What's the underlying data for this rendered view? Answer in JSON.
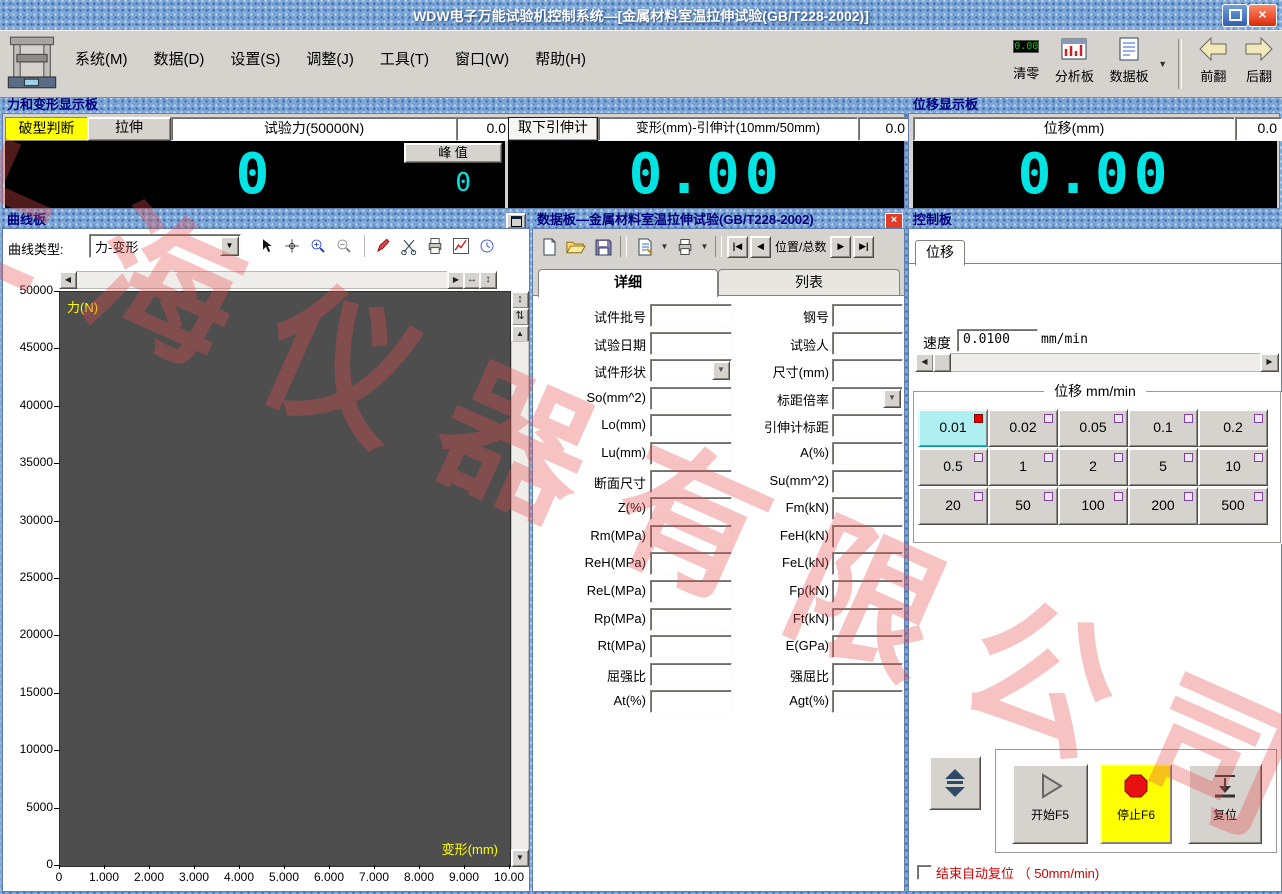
{
  "titlebar": {
    "title": "WDW电子万能试验机控制系统—[金属材料室温拉伸试验(GB/T228-2002)]"
  },
  "menubar": {
    "items": [
      "系统(M)",
      "数据(D)",
      "设置(S)",
      "调整(J)",
      "工具(T)",
      "窗口(W)",
      "帮助(H)"
    ],
    "tools": {
      "clear_zero": "清零",
      "analysis_board": "分析板",
      "data_board": "数据板",
      "prev_page": "前翻",
      "next_page": "后翻"
    }
  },
  "force_panel": {
    "title": "力和变形显示板",
    "break_judge_label": "破型判断",
    "tensile_label": "拉伸",
    "force_field_label": "试验力(50000N)",
    "force_value": "0.0",
    "force_display": "0",
    "peak_label": "峰 值",
    "peak_value": "0",
    "remove_extensometer_label": "取下引伸计",
    "deform_field_label": "变形(mm)-引伸计(10mm/50mm)",
    "deform_value": "0.0",
    "deform_display": "0.00"
  },
  "displacement_panel": {
    "title": "位移显示板",
    "field_label": "位移(mm)",
    "value": "0.0",
    "display": "0.00"
  },
  "curve_panel": {
    "title": "曲线板",
    "curve_type_label": "曲线类型:",
    "curve_type_value": "力-变形",
    "y_axis_name": "力(N)",
    "x_axis_name": "变形(mm)",
    "y_ticks": [
      "50000",
      "45000",
      "40000",
      "35000",
      "30000",
      "25000",
      "20000",
      "15000",
      "10000",
      "5000",
      "0"
    ],
    "x_ticks": [
      "0",
      "1.000",
      "2.000",
      "3.000",
      "4.000",
      "5.000",
      "6.000",
      "7.000",
      "8.000",
      "9.000",
      "10.00"
    ]
  },
  "chart_data": {
    "type": "line",
    "title": "力-变形",
    "xlabel": "变形(mm)",
    "ylabel": "力(N)",
    "xlim": [
      0,
      10
    ],
    "ylim": [
      0,
      50000
    ],
    "grid": false,
    "series": []
  },
  "data_panel": {
    "title": "数据板—金属材料室温拉伸试验(GB/T228-2002)",
    "nav_label": "位置/总数",
    "tabs": [
      "详细",
      "列表"
    ],
    "active_tab": "详细",
    "rows": [
      {
        "left_label": "试件批号",
        "left_value": "",
        "left_type": "text",
        "right_label": "钢号",
        "right_value": "",
        "right_type": "text"
      },
      {
        "left_label": "试验日期",
        "left_value": "",
        "left_type": "text",
        "right_label": "试验人",
        "right_value": "",
        "right_type": "text"
      },
      {
        "left_label": "试件形状",
        "left_value": "",
        "left_type": "select",
        "right_label": "尺寸(mm)",
        "right_value": "",
        "right_type": "text"
      },
      {
        "left_label": "So(mm^2)",
        "left_value": "",
        "left_type": "text",
        "right_label": "标距倍率",
        "right_value": "",
        "right_type": "select"
      },
      {
        "left_label": "Lo(mm)",
        "left_value": "",
        "left_type": "text",
        "right_label": "引伸计标距",
        "right_value": "",
        "right_type": "text"
      },
      {
        "left_label": "Lu(mm)",
        "left_value": "",
        "left_type": "text",
        "right_label": "A(%)",
        "right_value": "",
        "right_type": "text"
      },
      {
        "left_label": "断面尺寸",
        "left_value": "",
        "left_type": "text",
        "right_label": "Su(mm^2)",
        "right_value": "",
        "right_type": "text"
      },
      {
        "left_label": "Z(%)",
        "left_value": "",
        "left_type": "text",
        "right_label": "Fm(kN)",
        "right_value": "",
        "right_type": "text"
      },
      {
        "left_label": "Rm(MPa)",
        "left_value": "",
        "left_type": "text",
        "right_label": "FeH(kN)",
        "right_value": "",
        "right_type": "text"
      },
      {
        "left_label": "ReH(MPa)",
        "left_value": "",
        "left_type": "text",
        "right_label": "FeL(kN)",
        "right_value": "",
        "right_type": "text"
      },
      {
        "left_label": "ReL(MPa)",
        "left_value": "",
        "left_type": "text",
        "right_label": "Fp(kN)",
        "right_value": "",
        "right_type": "text"
      },
      {
        "left_label": "Rp(MPa)",
        "left_value": "",
        "left_type": "text",
        "right_label": "Ft(kN)",
        "right_value": "",
        "right_type": "text"
      },
      {
        "left_label": "Rt(MPa)",
        "left_value": "",
        "left_type": "text",
        "right_label": "E(GPa)",
        "right_value": "",
        "right_type": "text"
      },
      {
        "left_label": "屈强比",
        "left_value": "",
        "left_type": "text",
        "right_label": "强屈比",
        "right_value": "",
        "right_type": "text"
      },
      {
        "left_label": "At(%)",
        "left_value": "",
        "left_type": "text",
        "right_label": "Agt(%)",
        "right_value": "",
        "right_type": "text"
      }
    ]
  },
  "control_panel": {
    "title": "控制板",
    "tab_label": "位移",
    "speed_label": "速度",
    "speed_value": "0.0100",
    "speed_unit": "mm/min",
    "group_title": "位移 mm/min",
    "speed_options": [
      "0.01",
      "0.02",
      "0.05",
      "0.1",
      "0.2",
      "0.5",
      "1",
      "2",
      "5",
      "10",
      "20",
      "50",
      "100",
      "200",
      "500"
    ],
    "active_speed": "0.01",
    "start_label": "开始F5",
    "stop_label": "停止F6",
    "reset_label": "复位",
    "auto_reset_label": "结束自动复位 （ 50mm/min)"
  },
  "watermark": "上海仪器有限公司",
  "icons": {
    "close_glyph": "×",
    "dropdown": "▼",
    "nav_first": "|◀",
    "nav_prev": "◀",
    "nav_next": "▶",
    "nav_last": "▶|",
    "scroll_left": "◀",
    "scroll_right": "▶",
    "scroll_up": "▲",
    "scroll_down": "▼",
    "fit_h": "↔",
    "fit_all": "↕",
    "v_tool_1": "↕",
    "v_tool_2": "⇅"
  },
  "colors": {
    "lcd_cyan": "#00e4e4",
    "highlight_yellow": "#ffff00",
    "stop_red": "#e81010",
    "header_navy": "#00007e",
    "watermark_red": "#e64b4b"
  }
}
